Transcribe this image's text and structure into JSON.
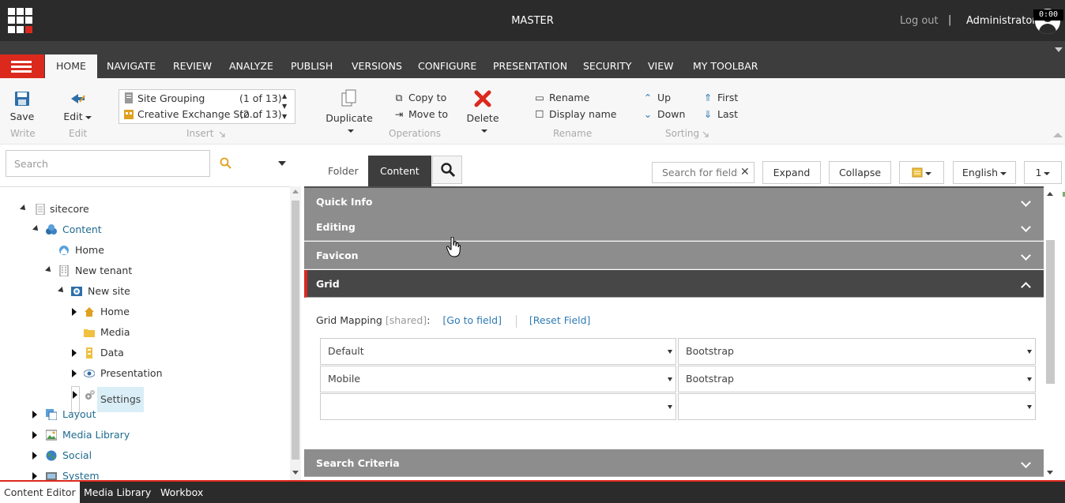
{
  "header": {
    "database": "MASTER",
    "logout": "Log out",
    "separator": "|",
    "user": "Administrator"
  },
  "ribbon_tabs": [
    "HOME",
    "NAVIGATE",
    "REVIEW",
    "ANALYZE",
    "PUBLISH",
    "VERSIONS",
    "CONFIGURE",
    "PRESENTATION",
    "SECURITY",
    "VIEW",
    "MY TOOLBAR"
  ],
  "ribbon": {
    "save": "Save",
    "edit": "Edit",
    "insert_items": [
      {
        "label": "Site Grouping",
        "count": "(1 of 13)"
      },
      {
        "label": "Creative Exchange Sto...",
        "count": "(2 of 13)"
      }
    ],
    "duplicate": "Duplicate",
    "copy_to": "Copy to",
    "move_to": "Move to",
    "delete": "Delete",
    "rename": "Rename",
    "display_name": "Display name",
    "up": "Up",
    "down": "Down",
    "first": "First",
    "last": "Last",
    "groups": {
      "write": "Write",
      "edit": "Edit",
      "insert": "Insert",
      "operations": "Operations",
      "rename": "Rename",
      "sorting": "Sorting"
    }
  },
  "search": {
    "placeholder": "Search"
  },
  "tree": {
    "sitecore": "sitecore",
    "content": "Content",
    "home": "Home",
    "new_tenant": "New tenant",
    "new_site": "New site",
    "site_home": "Home",
    "media": "Media",
    "data": "Data",
    "presentation": "Presentation",
    "settings": "Settings",
    "layout": "Layout",
    "media_library": "Media Library",
    "social": "Social",
    "system": "System"
  },
  "editor": {
    "tabs": {
      "folder": "Folder",
      "content": "Content"
    },
    "field_search_placeholder": "Search for fields",
    "expand": "Expand",
    "collapse": "Collapse",
    "language": "English",
    "version": "1",
    "sections": {
      "quick_info": "Quick Info",
      "editing": "Editing",
      "favicon": "Favicon",
      "grid": "Grid",
      "search_criteria": "Search Criteria"
    },
    "grid_mapping": {
      "label": "Grid Mapping",
      "shared": "[shared]",
      "colon": ":",
      "go_to_field": "[Go to field]",
      "reset_field": "[Reset Field]",
      "rows": [
        {
          "device": "Default",
          "system": "Bootstrap"
        },
        {
          "device": "Mobile",
          "system": "Bootstrap"
        },
        {
          "device": "",
          "system": ""
        }
      ]
    }
  },
  "bottom_tabs": [
    "Content Editor",
    "Media Library",
    "Workbox"
  ],
  "timer": "0:00",
  "colors": {
    "accent": "#dc291e",
    "dark": "#2b2b2b",
    "section": "#8d8d8d",
    "link": "#2f7ab3"
  }
}
